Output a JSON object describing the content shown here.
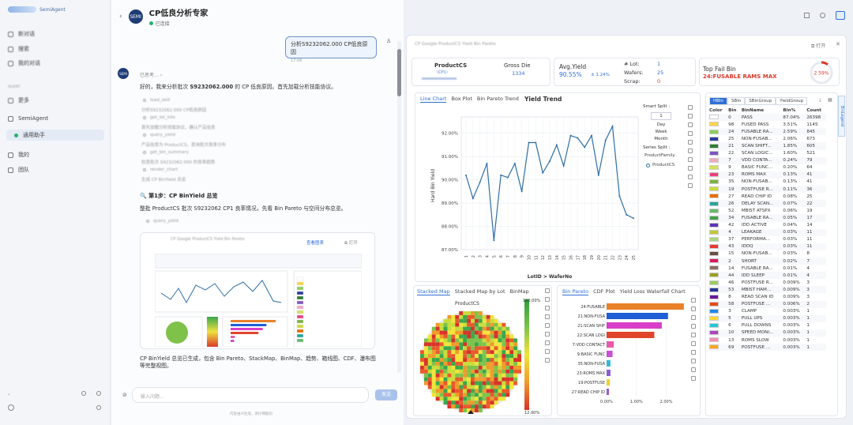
{
  "sidebar": {
    "logo_text": "SemiAgent",
    "items": [
      {
        "label": "新对话"
      },
      {
        "label": "搜索"
      },
      {
        "label": "我的对话"
      }
    ],
    "section_label": "AGENT",
    "sub_items": [
      {
        "label": "更多"
      }
    ],
    "semi_agent": "SemiAgent",
    "assistant": "通用助手",
    "mine": "我的",
    "team": "团队"
  },
  "chat": {
    "title": "CP低良分析专家",
    "status": "已连接",
    "avatar": "SEMI",
    "user_msg": "分析S9232062.000 CP低良原因",
    "user_time": "17:06",
    "thinking": "已思考…",
    "intro_a": "好的，我来分析批次 ",
    "intro_lot": "S9232062.000",
    "intro_b": " 的 CP 低良原因。首先加载分析技能协议。",
    "blurred_lines": [
      "分析S9232062.000 CP低良原因",
      "首先加载分析技能协议，确认产品信息",
      "产品信息为 ProductCS，查询批次良率分布",
      "检查批次 S9232062.000 的良率趋势",
      "生成 CP BinYield 总览"
    ],
    "steps": [
      "load_skill",
      "get_lot_info",
      "query_yield",
      "get_bin_summary",
      "render_chart"
    ],
    "step1_title": "第1步：CP BinYield 总览",
    "step1_desc": "整批 ProductCS 批次 S9232062 CP1 良率情况，先看 Bin Pareto 与空间分布总览。",
    "card_title": "CP Google ProductCS Yield Bin Pareto",
    "card_view": "查看图表",
    "card_open": "打开",
    "summary": "CP BinYield 总览已生成，包含 Bin Pareto、StackMap、BinMap、趋势、箱线图、CDF、瀑布图等完整视图。",
    "input_placeholder": "输入问题...",
    "send": "发送",
    "footer": "内容由AI生成，请仔细甄别"
  },
  "panel": {
    "title": "CP Google ProductCS Yield Bin Pareto",
    "open": "打开",
    "kpi": {
      "product_label": "ProductCS",
      "product_sub": "（CP1）",
      "gross_die_label": "Gross Die",
      "gross_die": "1334",
      "avg_yield_label": "Avg.Yield",
      "avg_yield": "90.55%",
      "avg_delta": "± 1.24%",
      "lot_label": "# Lot:",
      "lot": "1",
      "wafers_label": "Wafers:",
      "wafers": "25",
      "scrap_label": "Scrap:",
      "scrap": "0",
      "top_fail_label": "Top Fail Bin",
      "top_fail": "24:FUSABLE RAMS MAX",
      "top_fail_pct": "2.59%"
    },
    "trend": {
      "tabs": [
        "Line Chart",
        "Box Plot",
        "Bin Pareto Trend"
      ],
      "title": "Yield Trend",
      "smart_split": "Smart Split :",
      "split_value": "1",
      "options": [
        "Day",
        "Week",
        "Month"
      ],
      "series_split": "Series Split :",
      "series_family": "ProductFamily",
      "legend": "ProductCS",
      "xlabel": "LotID  >  WaferNo",
      "ylabel": "Hard Bin Yield"
    },
    "stack": {
      "tabs": [
        "Stacked Map",
        "Stacked Map by Lot",
        "BinMap"
      ],
      "title": "ProductCS",
      "scale_top": "100.00%",
      "scale_bottom": "12.00%"
    },
    "pareto": {
      "tabs": [
        "Bin Pareto",
        "CDF Plot",
        "Yield Loss Waterfall Chart"
      ]
    },
    "bins": {
      "tabs": [
        "HBin",
        "SBin",
        "SBinGroup",
        "YieldGroup"
      ],
      "headers": [
        "Color",
        "Bin",
        "BinName",
        "Bin%",
        "Count"
      ],
      "bin_legend": "BinLegend"
    }
  },
  "chart_data": [
    {
      "type": "line",
      "title": "Yield Trend",
      "xlabel": "LotID  >  WaferNo",
      "ylabel": "Hard Bin Yield",
      "x": [
        "1",
        "2",
        "3",
        "4",
        "5",
        "6",
        "7",
        "8",
        "9",
        "10",
        "11",
        "12",
        "13",
        "14",
        "15",
        "16",
        "17",
        "18",
        "19",
        "20",
        "21",
        "22",
        "23",
        "24",
        "25"
      ],
      "series": [
        {
          "name": "ProductCS",
          "values": [
            90.2,
            89.2,
            89.9,
            90.7,
            87.4,
            90.2,
            90.1,
            90.7,
            89.5,
            91.6,
            91.6,
            90.3,
            90.8,
            91.5,
            90.6,
            91.9,
            91.8,
            91.4,
            91.9,
            90.2,
            91.7,
            92.3,
            89.3,
            88.5,
            88.35
          ]
        }
      ],
      "ylim": [
        87.0,
        92.5
      ],
      "yticks": [
        "87.00%",
        "88.00%",
        "89.00%",
        "90.00%",
        "91.00%",
        "92.00%"
      ]
    },
    {
      "type": "bar",
      "title": "Bin Pareto",
      "categories": [
        "24:FUSABLE",
        "21:NON-FUSA",
        "21:SCAN SHIF",
        "22:SCAN LOGI",
        "7:VDD CONTACT",
        "9:BASIC FUNC",
        "35:NON-FUSA",
        "23:ROMS MAX",
        "19:POSTFUSE",
        "27:READ CHIP ID"
      ],
      "values": [
        2.59,
        2.06,
        1.85,
        1.6,
        0.24,
        0.2,
        0.13,
        0.13,
        0.11,
        0.08
      ],
      "colors": [
        "#e8812a",
        "#1f5fd6",
        "#d83ec8",
        "#e0452c",
        "#e85aa8",
        "#c94fd6",
        "#34b7d6",
        "#8a5bd6",
        "#f0d028",
        "#9a58d0"
      ],
      "xticks": [
        "0.00%",
        "1.00%",
        "2.00%"
      ],
      "xlim": [
        0,
        2.7
      ]
    },
    {
      "type": "table",
      "title": "HBin",
      "rows": [
        {
          "color": "#ffffff",
          "bin": "0",
          "name": "PASS",
          "pct": "87.04%",
          "count": "26398"
        },
        {
          "color": "#ffd54a",
          "bin": "98",
          "name": "FUSED PASS",
          "pct": "3.51%",
          "count": "1145"
        },
        {
          "color": "#8ccf5a",
          "bin": "24",
          "name": "FUSABLE RA...",
          "pct": "2.59%",
          "count": "845"
        },
        {
          "color": "#2d3e9c",
          "bin": "25",
          "name": "NON-FUSAB...",
          "pct": "2.06%",
          "count": "673"
        },
        {
          "color": "#2e7d32",
          "bin": "21",
          "name": "SCAN SHIFT...",
          "pct": "1.85%",
          "count": "605"
        },
        {
          "color": "#7e57c2",
          "bin": "22",
          "name": "SCAN LOGIC...",
          "pct": "1.60%",
          "count": "521"
        },
        {
          "color": "#f4a8c0",
          "bin": "7",
          "name": "VDD CONTA...",
          "pct": "0.24%",
          "count": "79"
        },
        {
          "color": "#d4e157",
          "bin": "9",
          "name": "BASIC FUNC...",
          "pct": "0.20%",
          "count": "64"
        },
        {
          "color": "#ec407a",
          "bin": "23",
          "name": "ROMS MAX",
          "pct": "0.13%",
          "count": "41"
        },
        {
          "color": "#7cb342",
          "bin": "35",
          "name": "NON-FUSAB...",
          "pct": "0.13%",
          "count": "41"
        },
        {
          "color": "#cddc39",
          "bin": "19",
          "name": "POSTFUSE R...",
          "pct": "0.11%",
          "count": "36"
        },
        {
          "color": "#ef6c00",
          "bin": "27",
          "name": "READ CHIP ID",
          "pct": "0.08%",
          "count": "25"
        },
        {
          "color": "#26a69a",
          "bin": "26",
          "name": "DELAY SCAN...",
          "pct": "0.07%",
          "count": "22"
        },
        {
          "color": "#66bb6a",
          "bin": "52",
          "name": "MBIST ATSPX",
          "pct": "0.06%",
          "count": "19"
        },
        {
          "color": "#43a047",
          "bin": "34",
          "name": "FUSABLE RA...",
          "pct": "0.05%",
          "count": "17"
        },
        {
          "color": "#5e35b1",
          "bin": "42",
          "name": "IDD ACTIVE",
          "pct": "0.04%",
          "count": "14"
        },
        {
          "color": "#c0ca33",
          "bin": "4",
          "name": "LEAKAGE",
          "pct": "0.03%",
          "count": "11"
        },
        {
          "color": "#aed581",
          "bin": "37",
          "name": "PERFORMA...",
          "pct": "0.03%",
          "count": "11"
        },
        {
          "color": "#e53935",
          "bin": "43",
          "name": "IDDQ",
          "pct": "0.03%",
          "count": "11"
        },
        {
          "color": "#6d4c41",
          "bin": "15",
          "name": "NON-FUSAB...",
          "pct": "0.03%",
          "count": "8"
        },
        {
          "color": "#d81b60",
          "bin": "2",
          "name": "SHORT",
          "pct": "0.02%",
          "count": "7"
        },
        {
          "color": "#8d6e63",
          "bin": "14",
          "name": "FUSABLE RA...",
          "pct": "0.01%",
          "count": "4"
        },
        {
          "color": "#9e9d24",
          "bin": "44",
          "name": "IDD SLEEP",
          "pct": "0.01%",
          "count": "4"
        },
        {
          "color": "#9ccc65",
          "bin": "46",
          "name": "POSTFUSE R...",
          "pct": "0.009%",
          "count": "3"
        },
        {
          "color": "#283593",
          "bin": "53",
          "name": "MBIST HAM...",
          "pct": "0.009%",
          "count": "3"
        },
        {
          "color": "#6a1b9a",
          "bin": "8",
          "name": "READ SCAN ID",
          "pct": "0.009%",
          "count": "3"
        },
        {
          "color": "#e64a19",
          "bin": "58",
          "name": "POSTFUSE ...",
          "pct": "0.006%",
          "count": "2"
        },
        {
          "color": "#1e88e5",
          "bin": "3",
          "name": "CLAMP",
          "pct": "0.003%",
          "count": "1"
        },
        {
          "color": "#fdd835",
          "bin": "5",
          "name": "PULL UPS",
          "pct": "0.003%",
          "count": "1"
        },
        {
          "color": "#26c6da",
          "bin": "6",
          "name": "PULL DOWNS",
          "pct": "0.003%",
          "count": "1"
        },
        {
          "color": "#ab47bc",
          "bin": "10",
          "name": "SPEED MONI...",
          "pct": "0.003%",
          "count": "1"
        },
        {
          "color": "#f48fb1",
          "bin": "13",
          "name": "ROMS SLOW",
          "pct": "0.003%",
          "count": "1"
        },
        {
          "color": "#f9a825",
          "bin": "69",
          "name": "POSTFUSE ...",
          "pct": "0.003%",
          "count": "1"
        }
      ]
    }
  ]
}
